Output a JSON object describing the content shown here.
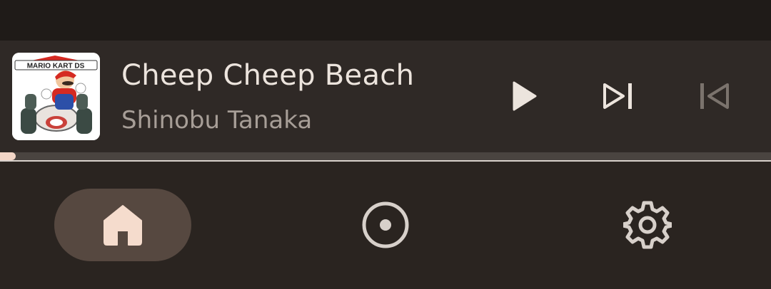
{
  "now_playing": {
    "album_art_icon": "album-art-icon",
    "album_art_text": "MARIO KART DS",
    "title": "Cheep Cheep Beach",
    "artist": "Shinobu Tanaka",
    "progress_fraction": 0.02
  },
  "controls": {
    "play_icon": "play-icon",
    "next_icon": "skip-next-icon",
    "previous_icon": "skip-previous-icon"
  },
  "nav": {
    "items": [
      {
        "icon": "home-icon",
        "selected": true
      },
      {
        "icon": "album-icon",
        "selected": false
      },
      {
        "icon": "gear-icon",
        "selected": false
      }
    ]
  },
  "colors": {
    "background": "#2b2521",
    "player_background": "#2f2926",
    "status_bar": "#1f1b18",
    "title_text": "#ece4dd",
    "artist_text": "#a79e97",
    "accent": "#f3d6c7",
    "nav_selected_pill": "#564840",
    "icon_default": "#d7d0ca"
  }
}
